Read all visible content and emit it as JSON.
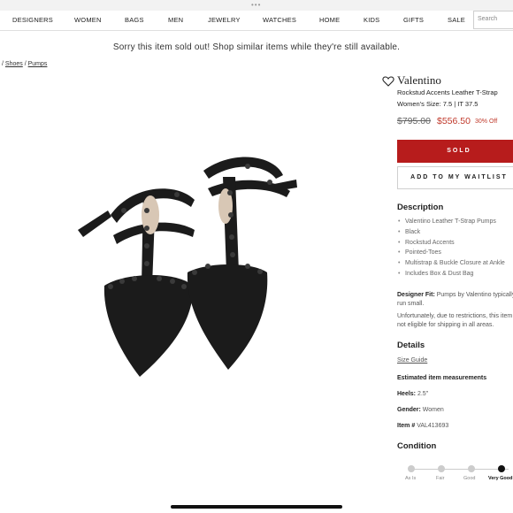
{
  "window": {
    "dots": "•••"
  },
  "nav": {
    "items": [
      "DESIGNERS",
      "WOMEN",
      "BAGS",
      "MEN",
      "JEWELRY",
      "WATCHES",
      "HOME",
      "KIDS",
      "GIFTS",
      "SALE"
    ],
    "search_placeholder": "Search"
  },
  "banner": {
    "text": "Sorry this item sold out! Shop similar items while they're still available."
  },
  "breadcrumb": {
    "sep1": "/",
    "shoes": "Shoes",
    "sep2": "/",
    "pumps": "Pumps"
  },
  "product": {
    "brand": "Valentino",
    "name": "Rockstud Accents Leather T-Strap",
    "size": "Women's Size: 7.5 | IT 37.5",
    "original_price": "$795.00",
    "price": "$556.50",
    "discount": "30% Off",
    "sold_label": "SOLD",
    "waitlist_label": "ADD TO MY WAITLIST"
  },
  "description": {
    "heading": "Description",
    "bullets": [
      "Valentino Leather T-Strap Pumps",
      "Black",
      "Rockstud Accents",
      "Pointed-Toes",
      "Multistrap & Buckle Closure at Ankle",
      "Includes Box & Dust Bag"
    ],
    "fit_label": "Designer Fit:",
    "fit_text": "Pumps by Valentino typically run small.",
    "shipping_note": "Unfortunately, due to restrictions, this item is not eligible for shipping in all areas."
  },
  "details": {
    "heading": "Details",
    "size_guide": "Size Guide",
    "measurements_label": "Estimated item measurements",
    "heels_label": "Heels:",
    "heels_value": "2.5\"",
    "gender_label": "Gender:",
    "gender_value": "Women",
    "item_label": "Item #",
    "item_value": "VAL413693"
  },
  "condition": {
    "heading": "Condition",
    "levels": [
      "As Is",
      "Fair",
      "Good",
      "Very Good"
    ],
    "selected": "Very Good"
  },
  "colors": {
    "sold": "#b71c1c",
    "sale": "#c0392b"
  },
  "icons": {
    "wishlist": "heart-icon"
  }
}
